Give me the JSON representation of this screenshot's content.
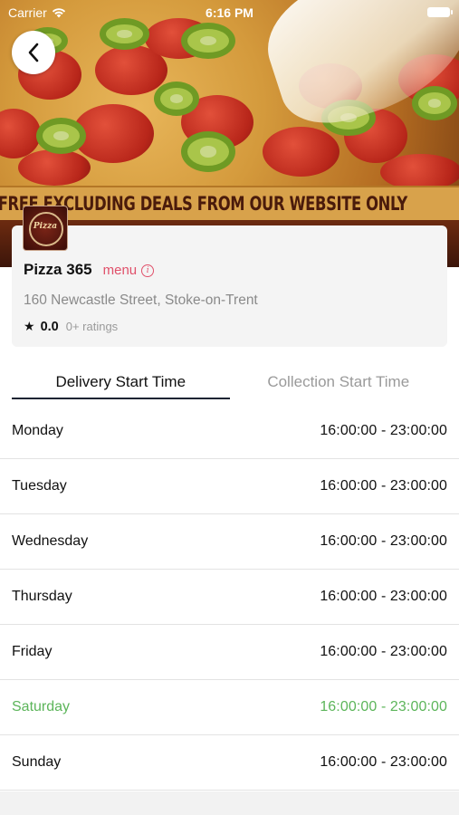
{
  "status_bar": {
    "carrier": "Carrier",
    "time": "6:16 PM"
  },
  "hero": {
    "banner_text": "FREE EXCLUDING DEALS FROM OUR WEBSITE ONLY"
  },
  "restaurant": {
    "logo_text": "Pizza",
    "name": "Pizza 365",
    "menu_label": "menu",
    "address": "160 Newcastle Street, Stoke-on-Trent",
    "rating": "0.0",
    "ratings_count": "0+ ratings"
  },
  "tabs": [
    {
      "label": "Delivery Start Time",
      "active": true
    },
    {
      "label": "Collection Start Time",
      "active": false
    }
  ],
  "hours": [
    {
      "day": "Monday",
      "time": "16:00:00 - 23:00:00",
      "today": false
    },
    {
      "day": "Tuesday",
      "time": "16:00:00 - 23:00:00",
      "today": false
    },
    {
      "day": "Wednesday",
      "time": "16:00:00 - 23:00:00",
      "today": false
    },
    {
      "day": "Thursday",
      "time": "16:00:00 - 23:00:00",
      "today": false
    },
    {
      "day": "Friday",
      "time": "16:00:00 - 23:00:00",
      "today": false
    },
    {
      "day": "Saturday",
      "time": "16:00:00 - 23:00:00",
      "today": true
    },
    {
      "day": "Sunday",
      "time": "16:00:00 - 23:00:00",
      "today": false
    }
  ],
  "colors": {
    "accent_today": "#5cb55a",
    "menu_link": "#e0506a",
    "tab_underline": "#1d2433"
  },
  "icons": {
    "back": "chevron-left-icon",
    "info": "info-icon",
    "star": "star-icon",
    "wifi": "wifi-icon",
    "battery": "battery-icon"
  }
}
